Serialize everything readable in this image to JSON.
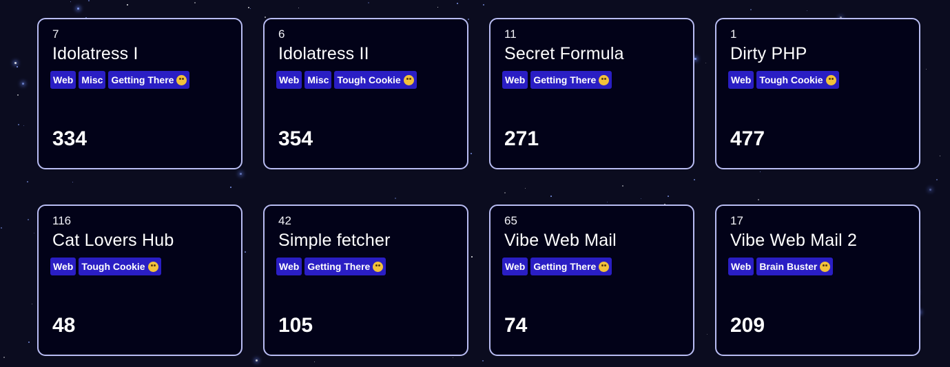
{
  "challenges": [
    {
      "solves": "7",
      "name": "Idolatress I",
      "tags": [
        "Web",
        "Misc",
        "Getting There"
      ],
      "difficulty_icon": "nerd-face-emoji",
      "points": "334"
    },
    {
      "solves": "6",
      "name": "Idolatress II",
      "tags": [
        "Web",
        "Misc",
        "Tough Cookie"
      ],
      "difficulty_icon": "pleading-face-emoji",
      "points": "354"
    },
    {
      "solves": "11",
      "name": "Secret Formula",
      "tags": [
        "Web",
        "Getting There"
      ],
      "difficulty_icon": "nerd-face-emoji",
      "points": "271"
    },
    {
      "solves": "1",
      "name": "Dirty PHP",
      "tags": [
        "Web",
        "Tough Cookie"
      ],
      "difficulty_icon": "pleading-face-emoji",
      "points": "477"
    },
    {
      "solves": "116",
      "name": "Cat Lovers Hub",
      "tags": [
        "Web",
        "Tough Cookie"
      ],
      "difficulty_icon": "pleading-face-emoji",
      "points": "48"
    },
    {
      "solves": "42",
      "name": "Simple fetcher",
      "tags": [
        "Web",
        "Getting There"
      ],
      "difficulty_icon": "nerd-face-emoji",
      "points": "105"
    },
    {
      "solves": "65",
      "name": "Vibe Web Mail",
      "tags": [
        "Web",
        "Getting There"
      ],
      "difficulty_icon": "nerd-face-emoji",
      "points": "74"
    },
    {
      "solves": "17",
      "name": "Vibe Web Mail 2",
      "tags": [
        "Web",
        "Brain Buster"
      ],
      "difficulty_icon": "exploding-head-emoji",
      "points": "209"
    }
  ],
  "colors": {
    "background": "#0b0c1f",
    "card_background": "#020218",
    "card_border": "#b9bdf3",
    "tag_background": "#2a1ec4",
    "text": "#ffffff"
  }
}
